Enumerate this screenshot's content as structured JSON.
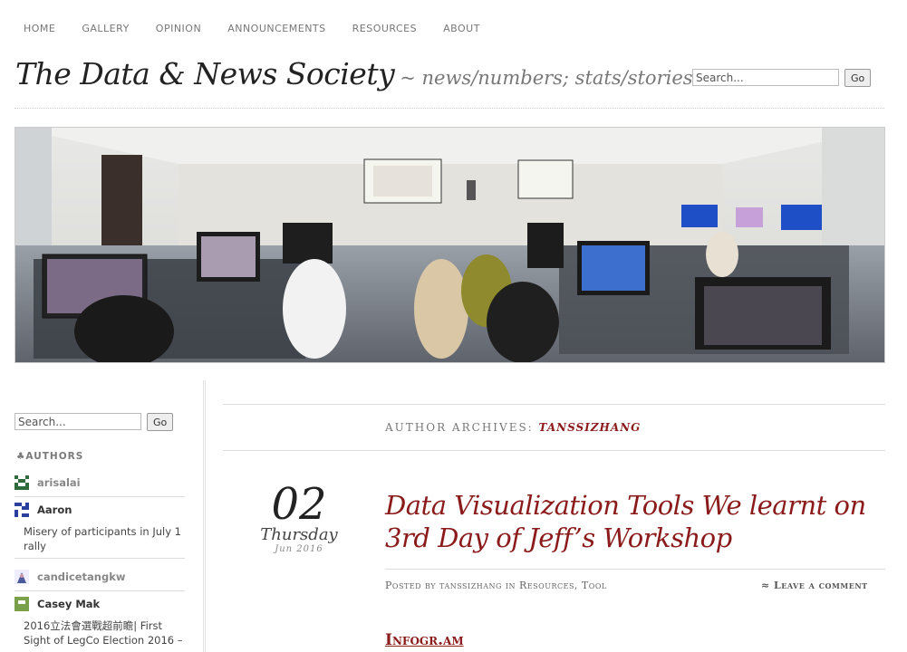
{
  "nav": [
    "HOME",
    "GALLERY",
    "OPINION",
    "ANNOUNCEMENTS",
    "RESOURCES",
    "ABOUT"
  ],
  "site": {
    "title": "The Data & News Society",
    "tagline": "~ news/numbers; stats/stories"
  },
  "search_top": {
    "placeholder": "Search...",
    "go": "Go"
  },
  "sidebar": {
    "search_placeholder": "Search...",
    "go": "Go",
    "authors_heading": "♣AUTHORS",
    "authors": [
      {
        "name": "arisalai",
        "post": ""
      },
      {
        "name": "Aaron",
        "post": "Misery of participants in July 1 rally"
      },
      {
        "name": "candicetangkw",
        "post": ""
      },
      {
        "name": "Casey Mak",
        "post": "2016立法會選戰超前瞻| First Sight of LegCo Election 2016 –"
      }
    ]
  },
  "archive": {
    "label": "AUTHOR ARCHIVES:",
    "name": "TANSSIZHANG"
  },
  "post": {
    "day": "02",
    "weekday": "Thursday",
    "month_year": "Jun 2016",
    "title": "Data Visualization Tools We learnt on 3rd Day of Jeff’s Workshop",
    "meta": "Posted by tanssizhang in Resources, Tool",
    "leave_comment": "≈ Leave a comment",
    "subheading": "Infogr.am"
  },
  "colors": {
    "accent": "#8b1a1a"
  }
}
